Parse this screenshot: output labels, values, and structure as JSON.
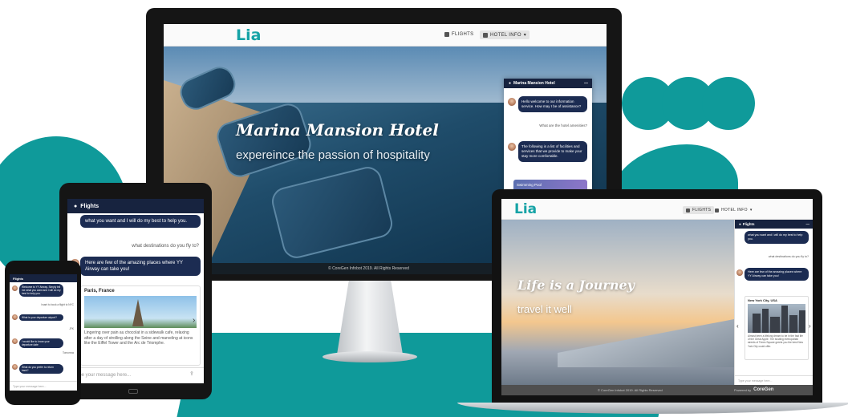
{
  "colors": {
    "teal": "#0f9a9a",
    "navy_bubble": "#1c2c52",
    "brand_logo": "#16a3a6"
  },
  "brand": {
    "logo": "Lia"
  },
  "desktop": {
    "nav": {
      "flights": "FLIGHTS",
      "hotel_info": "HOTEL INFO"
    },
    "hero_title": "Marina Mansion Hotel",
    "hero_subtitle": "expereince the passion of hospitality",
    "footer": "© CoreGen Infobot 2019. All Rights Reserved",
    "chat": {
      "header": "Marina Mansion Hotel",
      "bot_1": "Hello welcome to our information service. How may I be of assistance?",
      "user_1": "What are the hotel amenities?",
      "bot_2": "The following is a list of facilities and services that we provide to make your stay more comfortable.",
      "card": "Swimming Pool"
    }
  },
  "tablet": {
    "chat": {
      "header": "Flights",
      "bot_1": "what you want and I will do my best to help you.",
      "user_1": "what destinations do you fly to?",
      "bot_2": "Here are few of the amazing places where YY Airway can take you!",
      "card_title": "Paris, France",
      "card_text": "Lingering over pain au chocolat in a sidewalk cafe, relaxing after a day of strolling along the Seine and marveling at icons like the Eiffel Tower and the Arc de Triomphe.",
      "input_placeholder": "Type your message here..."
    }
  },
  "phone": {
    "chat": {
      "header": "Flights",
      "bot_1": "Welcome to YY Airway. Simply tell me what you want and I will do my best to help you.",
      "user_1": "I want to book a flight to NYC",
      "bot_2": "What is your departure airport?",
      "user_2": "JFK",
      "bot_3": "I would like to know your departure date",
      "user_3": "Tomorrow",
      "bot_4": "What do you prefer to return back?",
      "input_placeholder": "Type your message here..."
    }
  },
  "laptop": {
    "nav": {
      "flights": "FLIGHTS",
      "hotel_info": "HOTEL INFO"
    },
    "hero_title": "Life is a Journey",
    "hero_subtitle": "travel it well",
    "footer": "© CoreGen Infobot 2019. All Rights Reserved",
    "powered_by": "Powered by",
    "powered_brand": "CoreGen",
    "chat": {
      "header": "Flights",
      "bot_1": "what you want and I will do my best to help you.",
      "user_1": "what destinations do you fly to?",
      "bot_2": "Here are few of the amazing places where YY Airway can take you!",
      "card_title": "New York City, USA",
      "card_text": "Almost been a lifelong dream to be in the fast life of the Great Apple. The bustling metropolitan streets of Times Square greets you the best New York City could offer.",
      "input_placeholder": "Type your message here..."
    }
  }
}
